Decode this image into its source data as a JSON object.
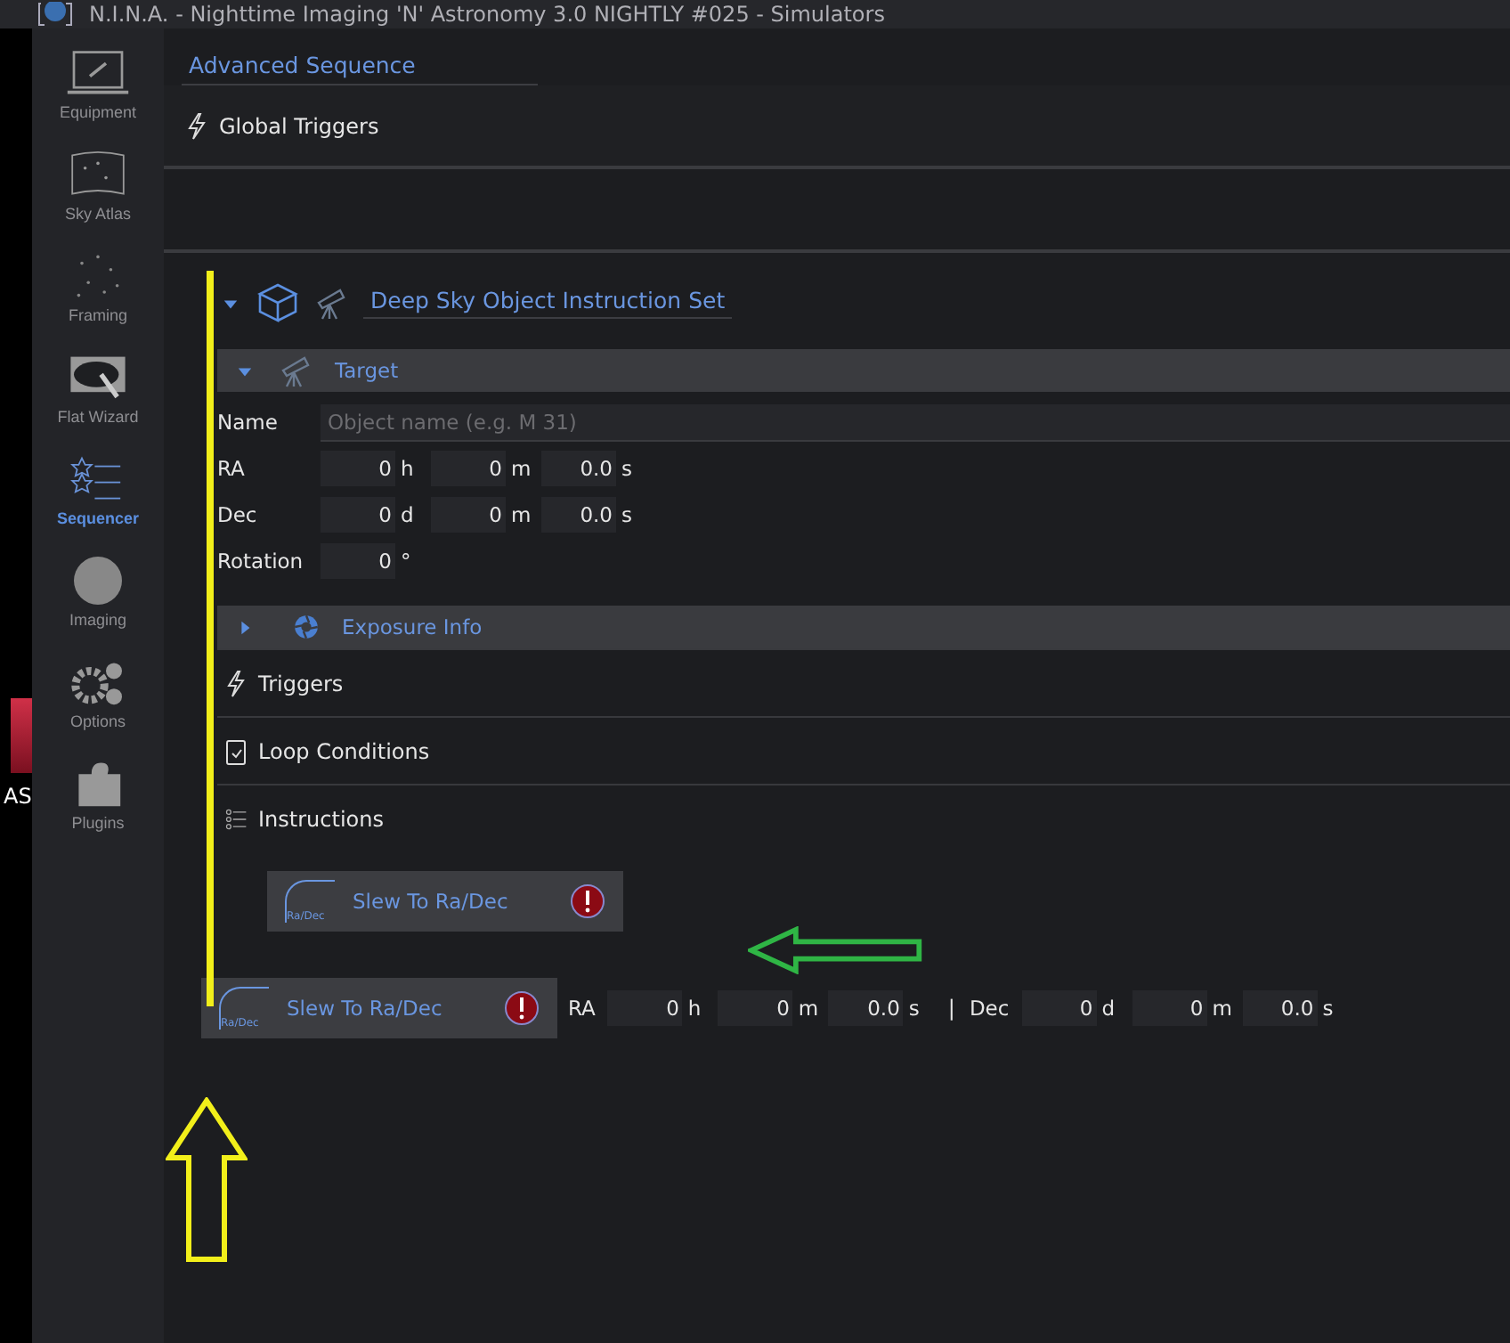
{
  "window": {
    "title": "N.I.N.A. - Nighttime Imaging 'N' Astronomy 3.0 NIGHTLY #025 - Simulators"
  },
  "desktop": {
    "icon_label": "AS"
  },
  "sidebar": {
    "items": [
      {
        "label": "Equipment",
        "kind": "laptop",
        "selected": false
      },
      {
        "label": "Sky Atlas",
        "kind": "map",
        "selected": false
      },
      {
        "label": "Framing",
        "kind": "stars",
        "selected": false
      },
      {
        "label": "Flat Wizard",
        "kind": "wand",
        "selected": false
      },
      {
        "label": "Sequencer",
        "kind": "list",
        "selected": true
      },
      {
        "label": "Imaging",
        "kind": "globe",
        "selected": false
      },
      {
        "label": "Options",
        "kind": "gears",
        "selected": false
      },
      {
        "label": "Plugins",
        "kind": "puzzle",
        "selected": false
      }
    ]
  },
  "tab": {
    "label": "Advanced Sequence"
  },
  "global_triggers": {
    "label": "Global Triggers"
  },
  "instruction_set": {
    "label": "Deep Sky Object Instruction Set",
    "expanded": true,
    "target": {
      "label": "Target",
      "expanded": true,
      "rows": [
        {
          "kind": "text",
          "label": "Name",
          "placeholder": "Object name (e.g. M 31)"
        },
        {
          "kind": "fields",
          "label": "RA",
          "fields": [
            {
              "value": "0",
              "unit": "h"
            },
            {
              "value": "0",
              "unit": "m"
            },
            {
              "value": "0.0",
              "unit": "s"
            }
          ]
        },
        {
          "kind": "fields",
          "label": "Dec",
          "fields": [
            {
              "value": "0",
              "unit": "d"
            },
            {
              "value": "0",
              "unit": "m"
            },
            {
              "value": "0.0",
              "unit": "s"
            }
          ]
        },
        {
          "kind": "fields",
          "label": "Rotation",
          "fields": [
            {
              "value": "0",
              "unit": "°"
            }
          ]
        }
      ]
    },
    "exposure_info": {
      "label": "Exposure Info",
      "expanded": false
    },
    "sections": [
      {
        "kind": "triggers",
        "label": "Triggers"
      },
      {
        "kind": "loop",
        "label": "Loop Conditions"
      },
      {
        "kind": "instructions",
        "label": "Instructions"
      }
    ],
    "instruction": {
      "label": "Slew To Ra/Dec",
      "icon_label": "Ra/Dec"
    }
  },
  "dragged_item": {
    "label": "Slew To Ra/Dec",
    "icon_label": "Ra/Dec",
    "ra_label": "RA",
    "ra": [
      {
        "value": "0",
        "unit": "h"
      },
      {
        "value": "0",
        "unit": "m"
      },
      {
        "value": "0.0",
        "unit": "s"
      }
    ],
    "separator": "|",
    "dec_label": "Dec",
    "dec": [
      {
        "value": "0",
        "unit": "d"
      },
      {
        "value": "0",
        "unit": "m"
      },
      {
        "value": "0.0",
        "unit": "s"
      }
    ]
  }
}
